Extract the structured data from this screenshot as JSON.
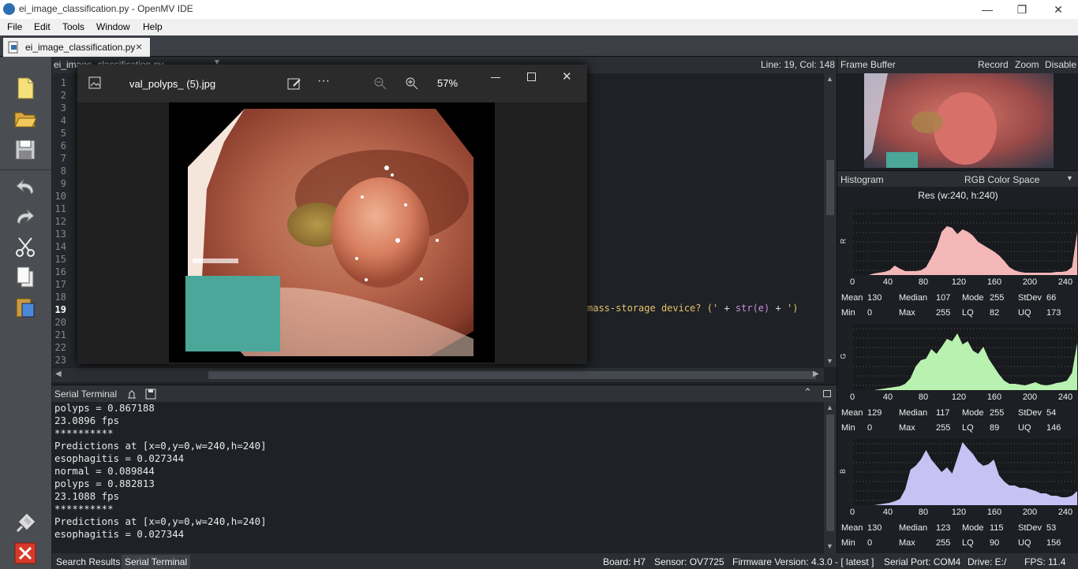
{
  "window": {
    "title": "ei_image_classification.py - OpenMV IDE",
    "minimize": "—",
    "restore": "❐",
    "close": "✕"
  },
  "menu": [
    "File",
    "Edit",
    "Tools",
    "Window",
    "Help"
  ],
  "file_tab": {
    "label": "ei_image_classification.py",
    "close": "×"
  },
  "editor": {
    "header_file": "ei_image_classification.py",
    "cursor_pos": "Line: 19, Col: 148",
    "line_numbers": [
      "1",
      "2",
      "3",
      "4",
      "5",
      "6",
      "7",
      "8",
      "9",
      "10",
      "11",
      "12",
      "13",
      "14",
      "15",
      "16",
      "17",
      "18",
      "19",
      "20",
      "21",
      "22",
      "23"
    ],
    "code_snippet": {
      "a": "mass-storage",
      "b": "device?",
      "c": "('",
      "d": "+",
      "e": "str(e)",
      "f": "+",
      "g": "')"
    }
  },
  "viewer": {
    "filename": "val_polyps_ (5).jpg",
    "zoom": "57%",
    "more": "···"
  },
  "serial": {
    "title": "Serial Terminal",
    "lines": [
      "polyps = 0.867188",
      "23.0896 fps",
      "**********",
      "Predictions at [x=0,y=0,w=240,h=240]",
      "esophagitis = 0.027344",
      "normal = 0.089844",
      "polyps = 0.882813",
      "23.1088 fps",
      "**********",
      "Predictions at [x=0,y=0,w=240,h=240]",
      "esophagitis = 0.027344"
    ]
  },
  "bottom_tabs": [
    "Search Results",
    "Serial Terminal"
  ],
  "status": {
    "board": "Board: H7",
    "sensor": "Sensor: OV7725",
    "firmware": "Firmware Version: 4.3.0 - [ latest ]",
    "port": "Serial Port: COM4",
    "drive": "Drive: E:/",
    "fps": "FPS:  11.4"
  },
  "frame_buffer": {
    "title": "Frame Buffer",
    "record": "Record",
    "zoom": "Zoom",
    "disable": "Disable"
  },
  "histogram": {
    "title": "Histogram",
    "color_space": "RGB Color Space",
    "res": "Res (w:240, h:240)",
    "x_ticks": [
      "0",
      "40",
      "80",
      "120",
      "160",
      "200",
      "240"
    ],
    "labels": {
      "mean": "Mean",
      "median": "Median",
      "mode": "Mode",
      "stdev": "StDev",
      "min": "Min",
      "max": "Max",
      "lq": "LQ",
      "uq": "UQ"
    },
    "channels": [
      {
        "name": "R",
        "color": "#f4b7b7",
        "mean": "130",
        "median": "107",
        "mode": "255",
        "stdev": "66",
        "min": "0",
        "max": "255",
        "lq": "82",
        "uq": "173",
        "profile": [
          0,
          0,
          0,
          0,
          2,
          3,
          4,
          6,
          12,
          8,
          5,
          5,
          5,
          6,
          10,
          22,
          35,
          55,
          62,
          60,
          52,
          58,
          55,
          50,
          42,
          38,
          34,
          30,
          25,
          18,
          10,
          6,
          4,
          3,
          3,
          3,
          3,
          3,
          3,
          4,
          4,
          5,
          10,
          55
        ]
      },
      {
        "name": "G",
        "color": "#b9f2b0",
        "mean": "129",
        "median": "117",
        "mode": "255",
        "stdev": "54",
        "min": "0",
        "max": "255",
        "lq": "89",
        "uq": "146",
        "profile": [
          0,
          0,
          0,
          0,
          0,
          1,
          2,
          3,
          4,
          5,
          8,
          15,
          30,
          38,
          40,
          52,
          46,
          55,
          65,
          62,
          72,
          58,
          62,
          50,
          46,
          55,
          40,
          30,
          20,
          12,
          8,
          8,
          7,
          6,
          8,
          10,
          7,
          6,
          7,
          9,
          10,
          12,
          22,
          60
        ]
      },
      {
        "name": "B",
        "color": "#c7c2f4",
        "mean": "130",
        "median": "123",
        "mode": "115",
        "stdev": "53",
        "min": "0",
        "max": "255",
        "lq": "90",
        "uq": "156",
        "profile": [
          0,
          0,
          0,
          0,
          0,
          1,
          2,
          3,
          5,
          8,
          20,
          45,
          50,
          58,
          70,
          58,
          50,
          42,
          48,
          40,
          60,
          80,
          72,
          65,
          55,
          50,
          52,
          58,
          38,
          30,
          25,
          25,
          22,
          22,
          20,
          18,
          15,
          15,
          12,
          12,
          10,
          10,
          12,
          18
        ]
      }
    ]
  }
}
